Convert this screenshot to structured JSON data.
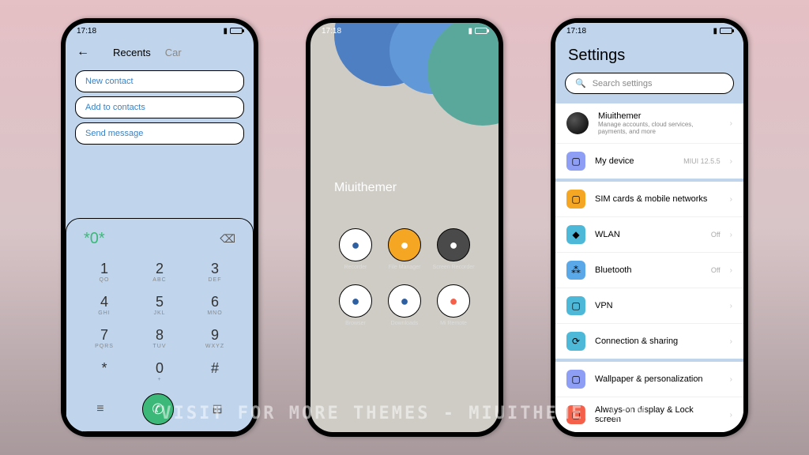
{
  "statusbar": {
    "time": "17:18"
  },
  "phone1": {
    "tabs": {
      "recents": "Recents",
      "cards": "Car"
    },
    "actions": {
      "new_contact": "New contact",
      "add_contacts": "Add to contacts",
      "send_message": "Send message"
    },
    "dial_text": "*0*",
    "keys": [
      {
        "n": "1",
        "s": "QO"
      },
      {
        "n": "2",
        "s": "ABC"
      },
      {
        "n": "3",
        "s": "DEF"
      },
      {
        "n": "4",
        "s": "GHI"
      },
      {
        "n": "5",
        "s": "JKL"
      },
      {
        "n": "6",
        "s": "MNO"
      },
      {
        "n": "7",
        "s": "PQRS"
      },
      {
        "n": "8",
        "s": "TUV"
      },
      {
        "n": "9",
        "s": "WXYZ"
      },
      {
        "n": "*",
        "s": ""
      },
      {
        "n": "0",
        "s": "+"
      },
      {
        "n": "#",
        "s": ""
      }
    ]
  },
  "phone2": {
    "title": "Miuithemer",
    "apps": [
      {
        "label": "Recorder",
        "bg": "#fff",
        "fg": "#2e5fa0"
      },
      {
        "label": "File Manager",
        "bg": "#f5a623",
        "fg": "#fff"
      },
      {
        "label": "Screen Recorder",
        "bg": "#4a4a4a",
        "fg": "#fff"
      },
      {
        "label": "Browser",
        "bg": "#fff",
        "fg": "#2e5fa0"
      },
      {
        "label": "Downloads",
        "bg": "#fff",
        "fg": "#2e5fa0"
      },
      {
        "label": "Mi Remote",
        "bg": "#fff",
        "fg": "#f5604a"
      }
    ]
  },
  "phone3": {
    "title": "Settings",
    "search_placeholder": "Search settings",
    "account": {
      "name": "Miuithemer",
      "sub": "Manage accounts, cloud services, payments, and more"
    },
    "device": {
      "label": "My device",
      "value": "MIUI 12.5.5"
    },
    "network": {
      "sim": "SIM cards & mobile networks",
      "wlan": {
        "label": "WLAN",
        "value": "Off"
      },
      "bluetooth": {
        "label": "Bluetooth",
        "value": "Off"
      },
      "vpn": "VPN",
      "connection": "Connection & sharing"
    },
    "display": {
      "wallpaper": "Wallpaper & personalization",
      "aod": "Always-on display & Lock screen"
    }
  },
  "watermark": "Visit for more themes - Miuithemer.com"
}
